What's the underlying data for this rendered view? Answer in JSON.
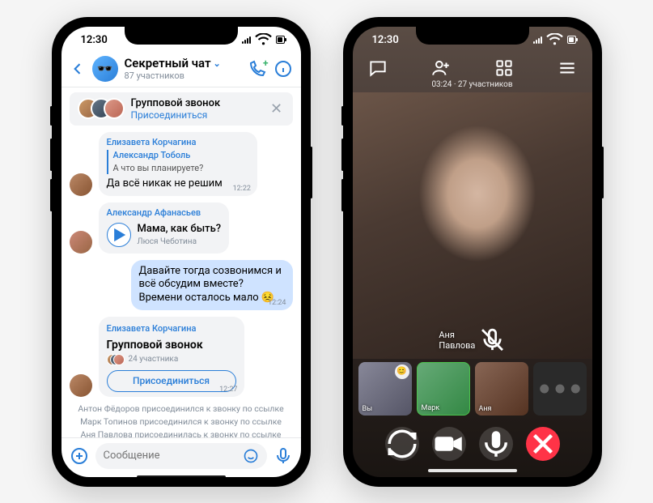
{
  "status_time": "12:30",
  "chat": {
    "title": "Секретный чат",
    "subtitle": "87 участников",
    "banner": {
      "title": "Групповой звонок",
      "join": "Присоединиться"
    },
    "msg1": {
      "name": "Елизавета Корчагина",
      "reply_name": "Александр Тоболь",
      "reply_text": "А что вы планируете?",
      "text": "Да всё никак не решим",
      "ts": "12:22"
    },
    "msg2": {
      "name": "Александр Афанасьев",
      "track": "Мама, как быть?",
      "artist": "Люся Чеботина"
    },
    "msg3": {
      "text": "Давайте тогда созвонимся и всё обсудим вместе? Времени осталось мало 😣",
      "ts": "12:24"
    },
    "msg4": {
      "name": "Елизавета Корчагина",
      "title": "Групповой звонок",
      "participants": "24 участника",
      "join": "Присоединиться",
      "ts": "12:27"
    },
    "sys1": "Антон Фёдоров присоединился к звонку по ссылке",
    "sys2": "Марк Топинов присоединился к звонку по ссылке",
    "sys3": "Аня Павлова присоединилась к звонку по ссылке",
    "placeholder": "Сообщение"
  },
  "call": {
    "duration": "03:24",
    "participants": "27 участников",
    "speaker": "Аня Павлова",
    "thumbs": {
      "t1": "Вы",
      "t2": "Марк",
      "t3": "Аня"
    }
  }
}
